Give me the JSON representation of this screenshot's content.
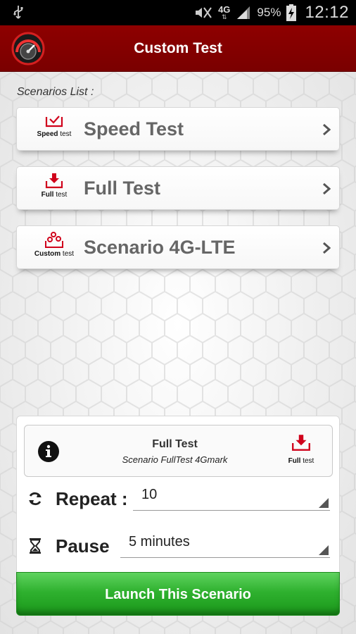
{
  "status_bar": {
    "battery": "95%",
    "time": "12:12",
    "network": "4G",
    "icons": [
      "usb-icon",
      "mute-icon",
      "signal-icon",
      "battery-charging-icon"
    ]
  },
  "header": {
    "title": "Custom Test",
    "logo_icon": "speedometer-icon"
  },
  "scenarios_label": "Scenarios List :",
  "scenarios": [
    {
      "title": "Speed Test",
      "caption_bold": "Speed",
      "caption_rest": " test",
      "icon": "speed-test-icon"
    },
    {
      "title": "Full Test",
      "caption_bold": "Full",
      "caption_rest": " test",
      "icon": "download-tray-icon"
    },
    {
      "title": "Scenario 4G-LTE",
      "caption_bold": "Custom",
      "caption_rest": " test",
      "icon": "custom-test-icon"
    }
  ],
  "selected_scenario": {
    "title": "Full Test",
    "subtitle": "Scenario FullTest 4Gmark",
    "caption_bold": "Full",
    "caption_rest": " test",
    "icon": "download-tray-icon"
  },
  "repeat": {
    "label": "Repeat :",
    "value": "10",
    "icon": "refresh-icon"
  },
  "pause": {
    "label": "Pause",
    "value": "5 minutes",
    "icon": "hourglass-icon"
  },
  "launch_button": {
    "label": "Launch This Scenario"
  },
  "colors": {
    "header_red": "#8e0000",
    "accent_red": "#d0021b",
    "launch_green": "#2fb12f"
  }
}
